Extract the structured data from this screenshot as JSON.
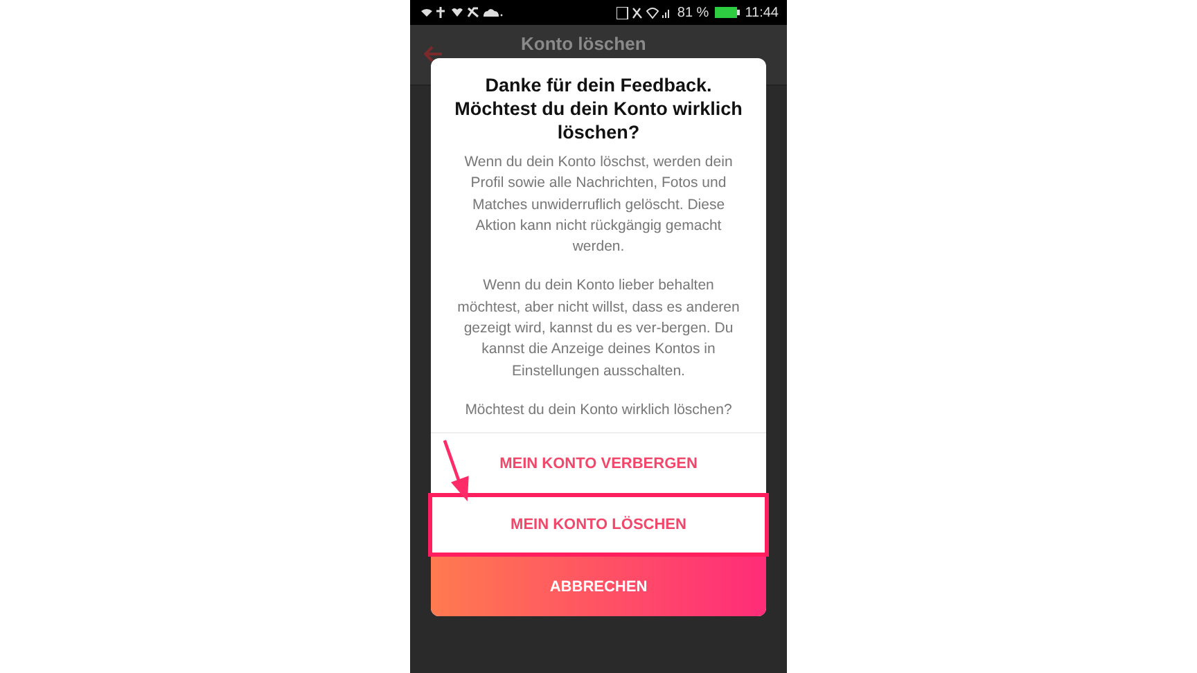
{
  "status_bar": {
    "battery": "81 %",
    "time": "11:44"
  },
  "header": {
    "title": "Konto löschen"
  },
  "dialog": {
    "title": "Danke für dein Feedback. Möchtest du dein Konto wirklich löschen?",
    "paragraphs": [
      "Wenn du dein Konto löschst, werden dein Profil sowie alle Nachrichten, Fotos und Matches unwiderruflich gelöscht. Diese Aktion kann nicht rückgängig gemacht werden.",
      "Wenn du dein Konto lieber behalten möchtest, aber nicht willst, dass es anderen gezeigt wird, kannst du es ver-bergen. Du kannst die Anzeige deines Kontos in Einstellungen ausschalten.",
      "Möchtest du dein Konto wirklich löschen?"
    ],
    "actions": [
      {
        "label": "MEIN KONTO VERBERGEN",
        "kind": "plain"
      },
      {
        "label": "MEIN KONTO LÖSCHEN",
        "kind": "highlighted"
      },
      {
        "label": "ABBRECHEN",
        "kind": "primary"
      }
    ]
  }
}
